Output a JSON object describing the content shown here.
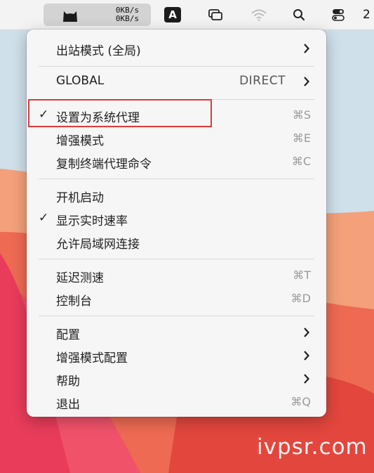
{
  "menubar": {
    "upload_speed": "0KB/s",
    "download_speed": "0KB/s",
    "ime_label": "A",
    "trailing_text": "2",
    "icons": [
      "clash-cat-icon",
      "screen-mirroring-icon",
      "wifi-icon",
      "spotlight-search-icon",
      "control-center-icon"
    ]
  },
  "menu": {
    "mode": {
      "label": "出站模式 (全局)"
    },
    "global": {
      "label": "GLOBAL",
      "value": "DIRECT"
    },
    "system_proxy": {
      "label": "设置为系统代理",
      "shortcut": "⌘S",
      "checked": true
    },
    "enhanced_mode": {
      "label": "增强模式",
      "shortcut": "⌘E"
    },
    "copy_cmd": {
      "label": "复制终端代理命令",
      "shortcut": "⌘C"
    },
    "launch_at_login": {
      "label": "开机启动"
    },
    "show_speed": {
      "label": "显示实时速率",
      "checked": true
    },
    "allow_lan": {
      "label": "允许局域网连接"
    },
    "latency_test": {
      "label": "延迟测速",
      "shortcut": "⌘T"
    },
    "dashboard": {
      "label": "控制台",
      "shortcut": "⌘D"
    },
    "config": {
      "label": "配置"
    },
    "enhanced_config": {
      "label": "增强模式配置"
    },
    "help": {
      "label": "帮助"
    },
    "quit": {
      "label": "退出",
      "shortcut": "⌘Q"
    },
    "check_mark": "✓"
  },
  "watermark": "ivpsr.com"
}
